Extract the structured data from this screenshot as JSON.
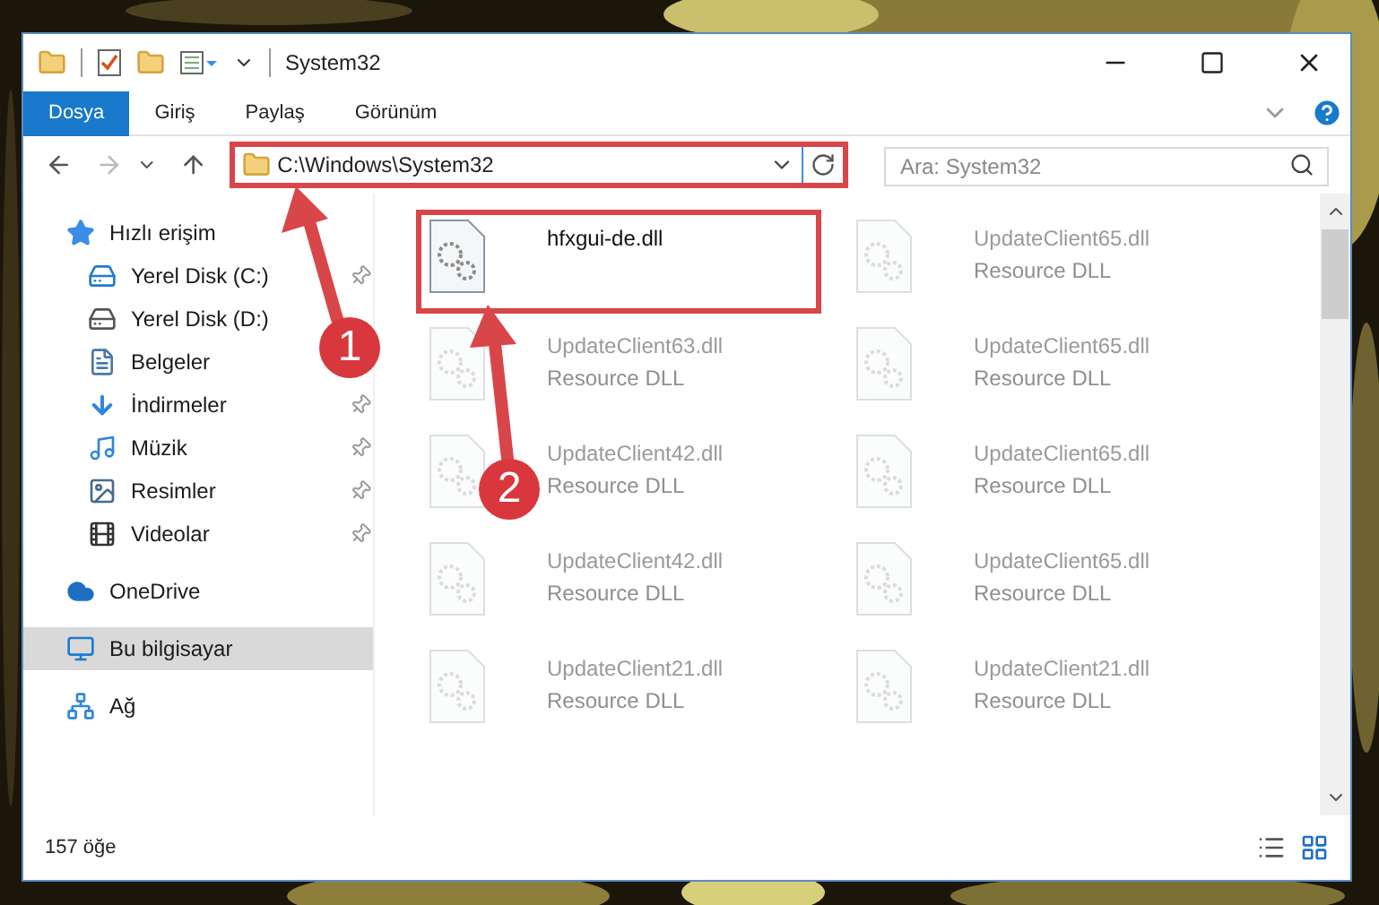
{
  "window": {
    "title": "System32"
  },
  "ribbon_tabs": [
    {
      "label": "Dosya",
      "selected": true
    },
    {
      "label": "Giriş",
      "selected": false
    },
    {
      "label": "Paylaş",
      "selected": false
    },
    {
      "label": "Görünüm",
      "selected": false
    }
  ],
  "address": {
    "path": "C:\\Windows\\System32",
    "highlighted": true
  },
  "search": {
    "placeholder": "Ara: System32"
  },
  "sidebar": {
    "items": [
      {
        "label": "Hızlı erişim",
        "kind": "star",
        "selected": false,
        "children": [
          {
            "label": "Yerel Disk (C:)",
            "kind": "system-disk",
            "pinned": true,
            "selected": false
          },
          {
            "label": "Yerel Disk (D:)",
            "kind": "disk",
            "selected": false
          },
          {
            "label": "Belgeler",
            "kind": "documents",
            "selected": false
          },
          {
            "label": "İndirmeler",
            "kind": "download",
            "pinned": true,
            "selected": false
          },
          {
            "label": "Müzik",
            "kind": "music",
            "pinned": true,
            "selected": false
          },
          {
            "label": "Resimler",
            "kind": "pictures",
            "pinned": true,
            "selected": false
          },
          {
            "label": "Videolar",
            "kind": "videos",
            "pinned": true,
            "selected": false
          }
        ]
      },
      {
        "label": "OneDrive",
        "kind": "cloud",
        "selected": false
      },
      {
        "label": "Bu bilgisayar",
        "kind": "computer",
        "selected": true
      },
      {
        "label": "Ağ",
        "kind": "network",
        "selected": false
      }
    ]
  },
  "files": [
    {
      "name": "hfxgui-de.dll",
      "highlighted": true,
      "dimmed": false
    },
    {
      "name": "UpdateClient65.dll",
      "type": "Resource DLL",
      "highlighted": false,
      "dimmed": true
    },
    {
      "name": "UpdateClient63.dll",
      "type": "Resource DLL",
      "highlighted": false,
      "dimmed": true
    },
    {
      "name": "UpdateClient65.dll",
      "type": "Resource DLL",
      "highlighted": false,
      "dimmed": true
    },
    {
      "name": "UpdateClient42.dll",
      "type": "Resource DLL",
      "highlighted": false,
      "dimmed": true
    },
    {
      "name": "UpdateClient65.dll",
      "type": "Resource DLL",
      "highlighted": false,
      "dimmed": true
    },
    {
      "name": "UpdateClient42.dll",
      "type": "Resource DLL",
      "highlighted": false,
      "dimmed": true
    },
    {
      "name": "UpdateClient65.dll",
      "type": "Resource DLL",
      "highlighted": false,
      "dimmed": true
    },
    {
      "name": "UpdateClient21.dll",
      "type": "Resource DLL",
      "highlighted": false,
      "dimmed": true
    },
    {
      "name": "UpdateClient21.dll",
      "type": "Resource DLL",
      "highlighted": false,
      "dimmed": true
    }
  ],
  "status_bar": {
    "item_count": "157 öğe"
  },
  "callouts": [
    {
      "label": "1"
    },
    {
      "label": "2"
    }
  ]
}
